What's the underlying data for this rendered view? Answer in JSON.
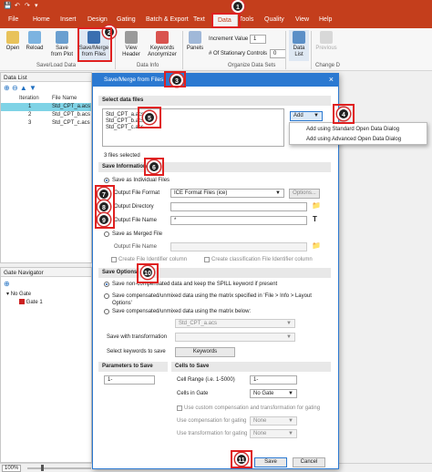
{
  "menu": {
    "file": "File",
    "home": "Home",
    "insert": "Insert",
    "design": "Design",
    "gating": "Gating",
    "batch": "Batch & Export",
    "text": "Text",
    "data": "Data",
    "tools": "Tools",
    "quality": "Quality",
    "view": "View",
    "help": "Help"
  },
  "ribbon": {
    "open": "Open",
    "reload": "Reload",
    "save_merge": "Save/Merge\nfrom Files",
    "save_from_plot": "Save\nfrom Plot",
    "view_header": "View\nHeader",
    "keywords_anonymizer": "Keywords\nAnonymizer",
    "panels": "Panels",
    "increment_value_label": "Increment Value",
    "increment_value": "1",
    "stationary_label": "# Of Stationary Controls",
    "stationary_value": "0",
    "data_list": "Data\nList",
    "previous": "Previous",
    "group_save_load": "Save/Load Data",
    "group_data_info": "Data Info",
    "group_organize": "Organize Data Sets",
    "group_change": "Change D"
  },
  "data_list": {
    "title": "Data List",
    "headers": {
      "iteration": "Iteration",
      "file_name": "File Name"
    },
    "rows": [
      {
        "iteration": "1",
        "file": "Std_CPT_a.acs"
      },
      {
        "iteration": "2",
        "file": "Std_CPT_b.acs"
      },
      {
        "iteration": "3",
        "file": "Std_CPT_c.acs"
      }
    ]
  },
  "gate_navigator": {
    "title": "Gate Navigator",
    "no_gate": "No Gate",
    "gate1": "Gate 1"
  },
  "status": {
    "zoom": "100%"
  },
  "dialog": {
    "title": "Save/Merge from Files",
    "select_section": "Select data files",
    "files": [
      "Std_CPT_a.acs",
      "Std_CPT_b.acs",
      "Std_CPT_c.acs"
    ],
    "add_button": "Add",
    "add_menu": [
      "Add using Standard Open Data Dialog",
      "Add using Advanced Open Data Dialog"
    ],
    "files_selected": "3 files selected",
    "save_info_section": "Save Information",
    "save_individual": "Save as Individual Files",
    "output_format_label": "Output File Format",
    "output_format_value": "ICE Format Files (ice)",
    "options_button": "Options...",
    "output_dir_label": "Output Directory",
    "output_name_label": "Output File Name",
    "output_name_value": "*",
    "save_merged": "Save as Merged File",
    "merged_name_label": "Output File Name",
    "create_file_id": "Create File Identifier column",
    "create_class_id": "Create classification File Identifier column",
    "save_options_section": "Save Options",
    "opt1": "Save non-compensated data and keep the SPILL keyword if present",
    "opt2": "Save compensated/unmixed data using the matrix specified in 'File > Info > Layout Options'",
    "opt3": "Save compensated/unmixed data using the matrix below:",
    "matrix_value": "Std_CPT_a.acs",
    "save_with_transformation": "Save with transformation",
    "select_keywords": "Select keywords to save",
    "keywords_button": "Keywords",
    "params_section": "Parameters to Save",
    "params_value": "1-",
    "cells_section": "Cells to Save",
    "cell_range_label": "Cell Range (i.e. 1-5000)",
    "cell_range_value": "1-",
    "cells_in_gate_label": "Cells in Gate",
    "cells_in_gate_value": "No Gate",
    "use_custom": "Use custom compensation and transformation for gating",
    "use_comp_label": "Use compensation for gating",
    "use_comp_value": "None",
    "use_trans_label": "Use transformation for gating",
    "use_trans_value": "None",
    "save_button": "Save",
    "cancel_button": "Cancel"
  },
  "badges": {
    "b1": "1",
    "b2": "2",
    "b3": "3",
    "b4": "4",
    "b5": "5",
    "b6": "6",
    "b7": "7",
    "b8": "8",
    "b9": "9",
    "b10": "10",
    "b11": "11"
  },
  "colors": {
    "accent": "#c43e1c",
    "dialog_title": "#2b79d1",
    "selection": "#7fd3e6",
    "badge_ring": "#d32f2f",
    "gate": "#cc2020"
  }
}
